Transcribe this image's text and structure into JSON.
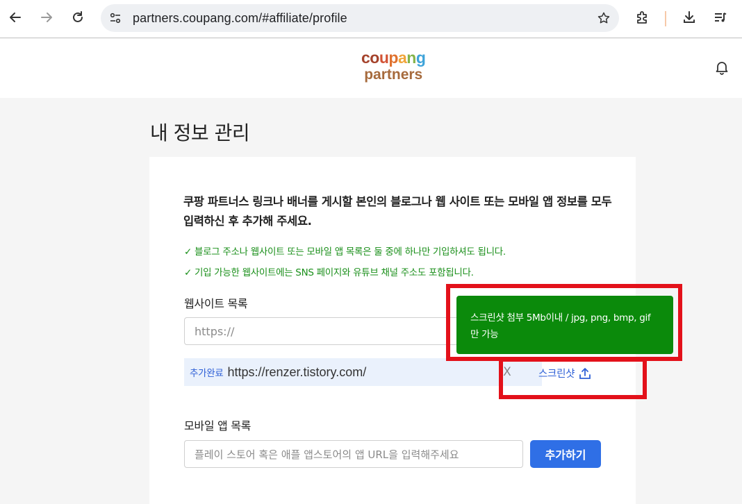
{
  "browser": {
    "url": "partners.coupang.com/#affiliate/profile"
  },
  "header": {
    "logo": {
      "top_letters": [
        {
          "ch": "c",
          "color": "#a5432c"
        },
        {
          "ch": "o",
          "color": "#a5432c"
        },
        {
          "ch": "u",
          "color": "#d35335"
        },
        {
          "ch": "p",
          "color": "#e0722f"
        },
        {
          "ch": "a",
          "color": "#f0a53a"
        },
        {
          "ch": "n",
          "color": "#84b34a"
        },
        {
          "ch": "g",
          "color": "#3ea3d9"
        }
      ],
      "bottom": "partners"
    }
  },
  "page": {
    "title": "내 정보 관리",
    "intro": "쿠팡 파트너스 링크나 배너를 게시할 본인의 블로그나 웹 사이트 또는 모바일 앱 정보를 모두 입력하신 후 추가해 주세요.",
    "notes": [
      "블로그 주소나 웹사이트 또는 모바일 앱 목록은 둘 중에 하나만 기입하셔도 됩니다.",
      "기입 가능한 웹사이트에는 SNS 페이지와 유튜브 채널 주소도 포함됩니다."
    ],
    "note_check": "✓",
    "website": {
      "label": "웹사이트 목록",
      "placeholder": "https://",
      "added_tag": "추가완료",
      "added_url": "https://renzer.tistory.com/",
      "remove": "X",
      "screenshot_label": "스크린샷"
    },
    "mobile": {
      "label": "모바일 앱 목록",
      "placeholder": "플레이 스토어 혹은 애플 앱스토어의 앱 URL을 입력해주세요",
      "add_button": "추가하기"
    },
    "tooltip": "스크린샷 첨부 5Mb이내 / jpg, png, bmp, gif 만 가능"
  },
  "colors": {
    "accent": "#2f6fe6",
    "tooltip_bg": "#0b8a0b",
    "note_green": "#1a8f1a",
    "highlight": "#e3111a"
  }
}
